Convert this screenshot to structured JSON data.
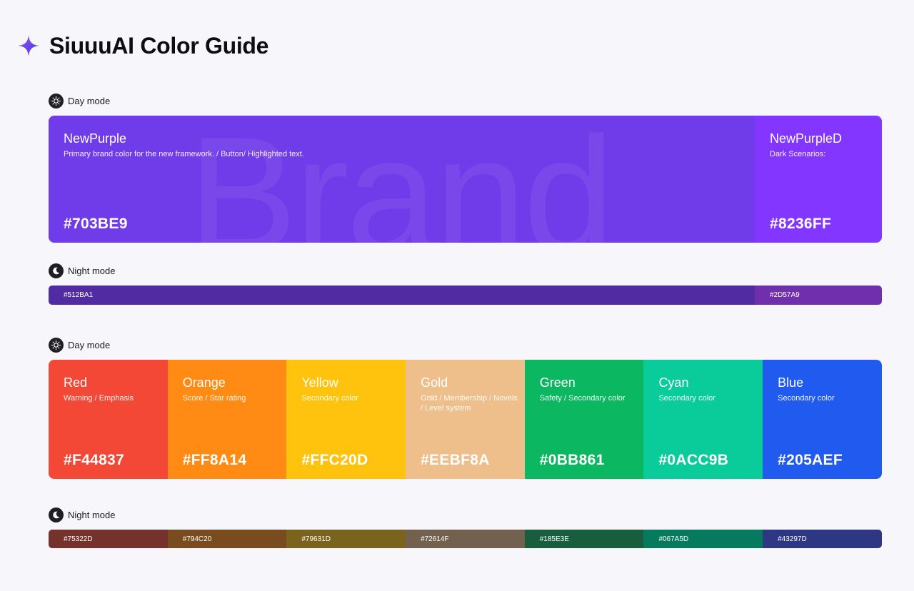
{
  "header": {
    "title": "SiuuuAI Color Guide",
    "logo_icon": "sparkle-icon"
  },
  "brand_section": {
    "day_label": "Day mode",
    "night_label": "Night mode",
    "watermark": "Brand",
    "primary": {
      "name": "NewPurple",
      "description": "Primary brand color for the new framework. / Button/ Highlighted text.",
      "hex": "#703BE9",
      "color": "#703BE9"
    },
    "dark": {
      "name": "NewPurpleD",
      "description": "Dark Scenarios:",
      "hex": "#8236FF",
      "color": "#8236FF"
    },
    "night": [
      {
        "hex": "#512BA1",
        "color": "#512BA1"
      },
      {
        "hex": "#2D57A9",
        "color": "#7030AD"
      }
    ]
  },
  "palette_section": {
    "day_label": "Day mode",
    "night_label": "Night mode",
    "swatches": [
      {
        "name": "Red",
        "description": "Warning / Emphasis",
        "hex": "#F44837",
        "color": "#F44837"
      },
      {
        "name": "Orange",
        "description": "Score / Star rating",
        "hex": "#FF8A14",
        "color": "#FF8A14"
      },
      {
        "name": "Yellow",
        "description": "Secondary color",
        "hex": "#FFC20D",
        "color": "#FFC20D"
      },
      {
        "name": "Gold",
        "description": "Gold / Membership / Novels / Level system",
        "hex": "#EEBF8A",
        "color": "#EEBF8A"
      },
      {
        "name": "Green",
        "description": "Safety / Secondary color",
        "hex": "#0BB861",
        "color": "#0BB861"
      },
      {
        "name": "Cyan",
        "description": "Secondary color",
        "hex": "#0ACC9B",
        "color": "#0ACC9B"
      },
      {
        "name": "Blue",
        "description": "Secondary color",
        "hex": "#205AEF",
        "color": "#205AEF"
      }
    ],
    "night": [
      {
        "hex": "#75322D",
        "color": "#75322D"
      },
      {
        "hex": "#794C20",
        "color": "#794C20"
      },
      {
        "hex": "#79631D",
        "color": "#79631D"
      },
      {
        "hex": "#72614F",
        "color": "#72614F"
      },
      {
        "hex": "#185E3E",
        "color": "#185E3E"
      },
      {
        "hex": "#067A5D",
        "color": "#067A5D"
      },
      {
        "hex": "#43297D",
        "color": "#2E3783"
      }
    ]
  }
}
